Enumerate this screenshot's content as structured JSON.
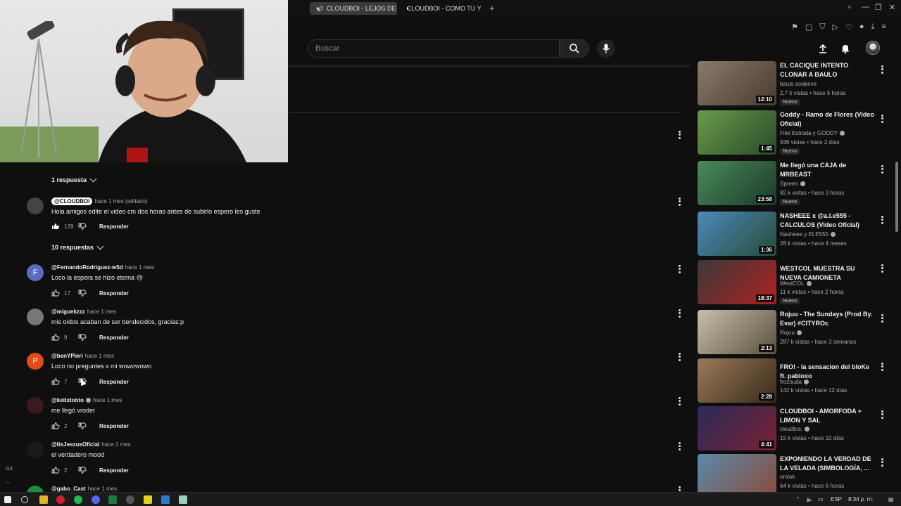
{
  "browser": {
    "tabs": [
      {
        "label": "CLOUDBOI - LEJOS DE",
        "active": true
      },
      {
        "label": "CLOUDBOI - COMO TU Y",
        "active": false
      }
    ],
    "new_tab": "+"
  },
  "header": {
    "search_placeholder": "Buscar"
  },
  "comments": {
    "thread_toggle_1": "1 respuesta",
    "thread_toggle_2": "10 respuestas",
    "items": [
      {
        "user": "@CLOUDBOI",
        "time": "hace 1 mes (editado)",
        "text": "Hola amigos edite el video cm dos horas antes de subirlo espero les guste",
        "likes": "129",
        "reply": "Responder",
        "avatar_letter": "",
        "avatar_color": "#555555"
      },
      {
        "user": "@FernandoRodriguez-w5d",
        "time": "hace 1 mes",
        "text": "Loco la espera se hizo eterna 😢",
        "likes": "17",
        "reply": "Responder",
        "avatar_letter": "F",
        "avatar_color": "#5c6bc0"
      },
      {
        "user": "@miguekzzz",
        "time": "hace 1 mes",
        "text": "mis oídos acaban de ser bendecidos, gracias:p",
        "likes": "9",
        "reply": "Responder",
        "avatar_letter": "",
        "avatar_color": "#777777"
      },
      {
        "user": "@benYPieri",
        "time": "hace 1 mes",
        "text": "Loco no preguntes x mi wowowowo",
        "likes": "7",
        "reply": "Responder",
        "avatar_letter": "P",
        "avatar_color": "#e64a19"
      },
      {
        "user": "@keitxtonto",
        "time": "hace 1 mes",
        "text": "me llegó vroder",
        "likes": "2",
        "reply": "Responder",
        "avatar_letter": "",
        "avatar_color": "#3a1a1a"
      },
      {
        "user": "@ItsJeezusOficial",
        "time": "hace 1 mes",
        "text": "el verdadero mood",
        "likes": "2",
        "reply": "Responder",
        "avatar_letter": "",
        "avatar_color": "#1a1a1a"
      },
      {
        "user": "@gabo_Cast",
        "time": "hace 1 mes",
        "text": "",
        "likes": "",
        "reply": "",
        "avatar_letter": "",
        "avatar_color": "#1e8e3e"
      }
    ]
  },
  "sidebar": {
    "videos": [
      {
        "title": "EL CACIQUE INTENTO CLONAR A BAULO",
        "channel": "baulo anakeve",
        "verified": false,
        "meta": "2,7 k vistas • hace 5 horas",
        "duration": "12:10",
        "nuevo": "Nuevo",
        "thumb_color": "#6a5a4a"
      },
      {
        "title": "Goddy - Ramo de Flores (Video Oficial)",
        "channel": "Filei Estrada y GODDY",
        "verified": true,
        "meta": "936 vistas • hace 2 días",
        "duration": "1:45",
        "nuevo": "Nuevo",
        "thumb_color": "#4a7a3a"
      },
      {
        "title": "Me llegó una CAJA de MRBEAST",
        "channel": "Spreen",
        "verified": true,
        "meta": "82 k vistas • hace 3 horas",
        "duration": "23:58",
        "nuevo": "Nuevo",
        "thumb_color": "#3a6a4a"
      },
      {
        "title": "NASHEEE x @a.l.e555 - CALCULOS (Video Oficial)",
        "channel": "Nasheee y ELE555",
        "verified": true,
        "meta": "28 k vistas • hace 4 meses",
        "duration": "1:36",
        "nuevo": "",
        "thumb_color": "#2a5a8a"
      },
      {
        "title": "WESTCOL MUESTRA SU NUEVA CAMIONETA",
        "channel": "WestCOL",
        "verified": true,
        "meta": "11 k vistas • hace 2 horas",
        "duration": "18:37",
        "nuevo": "Nuevo",
        "thumb_color": "#8a2a2a"
      },
      {
        "title": "Rojuu - The Sundays (Prod By. Evar) #CITYROc",
        "channel": "Rojuu",
        "verified": true,
        "meta": "287 k vistas • hace 3 semanas",
        "duration": "2:13",
        "nuevo": "",
        "thumb_color": "#8a8a7a"
      },
      {
        "title": "FRO! - la sensacion del bloKe ft. pabloxo",
        "channel": "frozouda",
        "verified": true,
        "meta": "142 k vistas • hace 12 días",
        "duration": "2:28",
        "nuevo": "",
        "thumb_color": "#6a5a4a"
      },
      {
        "title": "CLOUDBOI - AMORFODA + LIMON Y SAL",
        "channel": "cloudboi.",
        "verified": true,
        "meta": "15 k vistas • hace 10 días",
        "duration": "4:41",
        "nuevo": "",
        "thumb_color": "#1a1a3a"
      },
      {
        "title": "EXPONIENDO LA VERDAD DE LA VELADA (SIMBOLOGÍA, ...",
        "channel": "orslok",
        "verified": false,
        "meta": "64 k vistas • hace 6 horas",
        "duration": "",
        "nuevo": "",
        "thumb_color": "#4a6a7a"
      }
    ]
  },
  "left_rail": {
    "label": "GX",
    "more": "..."
  },
  "taskbar": {
    "lang": "ESP",
    "time": "8:34 p. m."
  }
}
